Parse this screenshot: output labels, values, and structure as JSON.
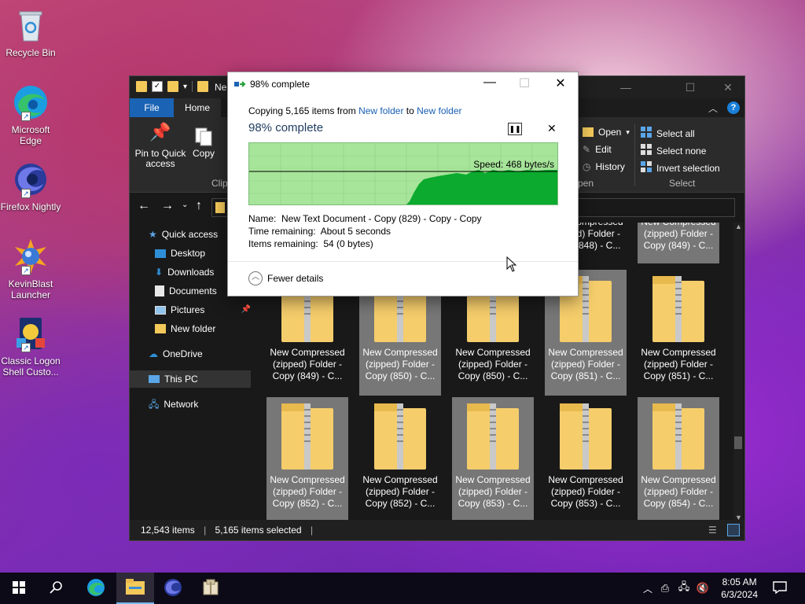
{
  "desktop": {
    "icons": [
      {
        "label": "Recycle Bin",
        "icon": "recycle-bin-icon"
      },
      {
        "label": "Microsoft Edge",
        "icon": "edge-icon"
      },
      {
        "label": "Firefox Nightly",
        "icon": "firefox-nightly-icon"
      },
      {
        "label": "KevinBlast Launcher",
        "icon": "kevinblast-icon"
      },
      {
        "label": "Classic Logon Shell Custo...",
        "icon": "classic-logon-icon"
      }
    ]
  },
  "explorer": {
    "title": "Ne",
    "tabs": {
      "file": "File",
      "home": "Home"
    },
    "ribbon": {
      "pin_label": "Pin to Quick access",
      "copy_label": "Copy",
      "clipboard_group": "Clip",
      "open_label": "Open",
      "edit_label": "Edit",
      "history_label": "History",
      "open_group": "pen",
      "select_all": "Select all",
      "select_none": "Select none",
      "invert_selection": "Invert selection",
      "select_group": "Select"
    },
    "sidebar": [
      {
        "label": "Quick access",
        "icon": "star-icon"
      },
      {
        "label": "Desktop",
        "icon": "desktop-folder-icon"
      },
      {
        "label": "Downloads",
        "icon": "download-icon"
      },
      {
        "label": "Documents",
        "icon": "documents-icon"
      },
      {
        "label": "Pictures",
        "icon": "pictures-icon"
      },
      {
        "label": "New folder",
        "icon": "folder-icon"
      },
      {
        "label": "OneDrive",
        "icon": "cloud-icon"
      },
      {
        "label": "This PC",
        "icon": "computer-icon"
      },
      {
        "label": "Network",
        "icon": "network-icon"
      }
    ],
    "tiles_row0": [
      {
        "label": "New Compressed (zipped) Folder - Copy (848) - C...",
        "clipped_top": "New"
      },
      {
        "label": "New Compressed (zipped) Folder - Copy (849) - C..."
      }
    ],
    "tiles_row1": [
      {
        "label": "New Compressed (zipped) Folder - Copy (849) - C...",
        "selected": false
      },
      {
        "label": "New Compressed (zipped) Folder - Copy (850) - C...",
        "selected": true
      },
      {
        "label": "New Compressed (zipped) Folder - Copy (850) - C...",
        "selected": false
      },
      {
        "label": "New Compressed (zipped) Folder - Copy (851) - C...",
        "selected": true
      },
      {
        "label": "New Compressed (zipped) Folder - Copy (851) - C...",
        "selected": false
      }
    ],
    "tiles_row2": [
      {
        "label": "New Compressed (zipped) Folder - Copy (852) - C...",
        "selected": true
      },
      {
        "label": "New Compressed (zipped) Folder - Copy (852) - C...",
        "selected": false
      },
      {
        "label": "New Compressed (zipped) Folder - Copy (853) - C...",
        "selected": true
      },
      {
        "label": "New Compressed (zipped) Folder - Copy (853) - C...",
        "selected": false
      },
      {
        "label": "New Compressed (zipped) Folder - Copy (854) - C...",
        "selected": true
      }
    ],
    "status": {
      "items": "12,543 items",
      "selected": "5,165 items selected"
    }
  },
  "copy_dialog": {
    "title": "98% complete",
    "copying_prefix": "Copying 5,165 items from",
    "source": "New folder",
    "to_word": "to",
    "destination": "New folder",
    "percent_label": "98% complete",
    "progress": 0.98,
    "speed": "Speed: 468 bytes/s",
    "name_label": "Name:",
    "name_value": "New Text Document - Copy (829) - Copy - Copy",
    "time_label": "Time remaining:",
    "time_value": "About 5 seconds",
    "items_label": "Items remaining:",
    "items_value": "54 (0 bytes)",
    "fewer_details": "Fewer details"
  },
  "taskbar": {
    "time": "8:05 AM",
    "date": "6/3/2024",
    "apps": [
      "start-icon",
      "search-icon",
      "edge-icon",
      "file-explorer-icon",
      "firefox-nightly-icon",
      "archive-icon"
    ]
  },
  "colors": {
    "accent": "#1a63b5",
    "progress_fill": "#0caa2e",
    "progress_bg": "#a7e59a",
    "link": "#1a5fb4"
  }
}
